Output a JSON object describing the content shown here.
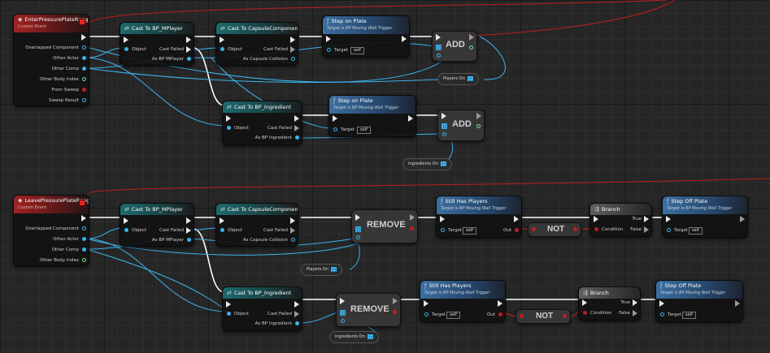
{
  "enter_event": {
    "title": "EnterPressurePlateRange",
    "subtitle": "Custom Event",
    "pins": [
      "Overlapped Component",
      "Other Actor",
      "Other Comp",
      "Other Body Index",
      "From Sweep",
      "Sweep Result"
    ]
  },
  "leave_event": {
    "title": "LeavePressurePlateRange",
    "subtitle": "Custom Event",
    "pins": [
      "Overlapped Component",
      "Other Actor",
      "Other Comp",
      "Other Body Index"
    ]
  },
  "cast_mplayer": {
    "title": "Cast To BP_MPlayer",
    "object": "Object",
    "cast_failed": "Cast Failed",
    "as_output": "As BP MPlayer"
  },
  "cast_capsule": {
    "title": "Cast To CapsuleComponent",
    "object": "Object",
    "cast_failed": "Cast Failed",
    "as_output": "As Capsule Collision"
  },
  "cast_ingredient": {
    "title": "Cast To BP_Ingredient",
    "object": "Object",
    "cast_failed": "Cast Failed",
    "as_output": "As BP Ingredient"
  },
  "step_on": {
    "title": "Step on Plate",
    "subtitle": "Target is BP Moving Wall Trigger",
    "target": "Target",
    "self": "self"
  },
  "step_off": {
    "title": "Step Off Plate",
    "subtitle": "Target is BP Moving Wall Trigger",
    "target": "Target",
    "self": "self"
  },
  "still_has_players": {
    "title": "Still Has Players",
    "subtitle": "Target is BP Moving Wall Trigger",
    "target": "Target",
    "self": "self",
    "out": "Out"
  },
  "branch": {
    "title": "Branch",
    "true_label": "True",
    "false_label": "False",
    "condition": "Condition"
  },
  "ops": {
    "add": "ADD",
    "remove": "REMOVE",
    "not": "NOT"
  },
  "vars": {
    "players_on": "Players On",
    "ingredients_on": "Ingredients On"
  },
  "colors": {
    "exec_wire": "#ffffff",
    "object_wire": "#3cb3ee",
    "bool_wire": "#c01e1e",
    "event_header": "#a52222",
    "cast_header": "#1c6a6e",
    "function_header": "#3c6fa0"
  }
}
